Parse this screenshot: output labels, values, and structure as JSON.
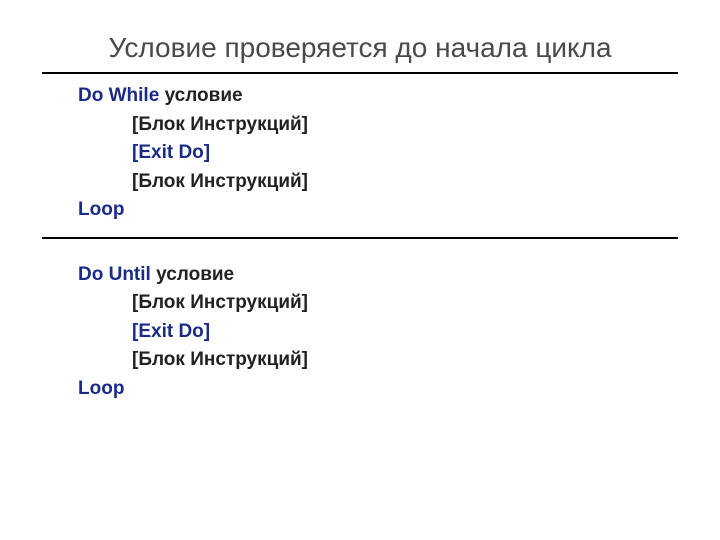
{
  "title": "Условие проверяется до начала цикла",
  "block1": {
    "line1_kw": "Do While ",
    "line1_cond": "условие",
    "line2": "[Блок Инструкций]",
    "line3": "[Exit Do]",
    "line4": "[Блок Инструкций]",
    "line5": "Loop"
  },
  "block2": {
    "line1_kw": "Do Until ",
    "line1_cond": "условие",
    "line2": "[Блок Инструкций]",
    "line3": "[Exit Do]",
    "line4": "[Блок Инструкций]",
    "line5": "Loop"
  }
}
